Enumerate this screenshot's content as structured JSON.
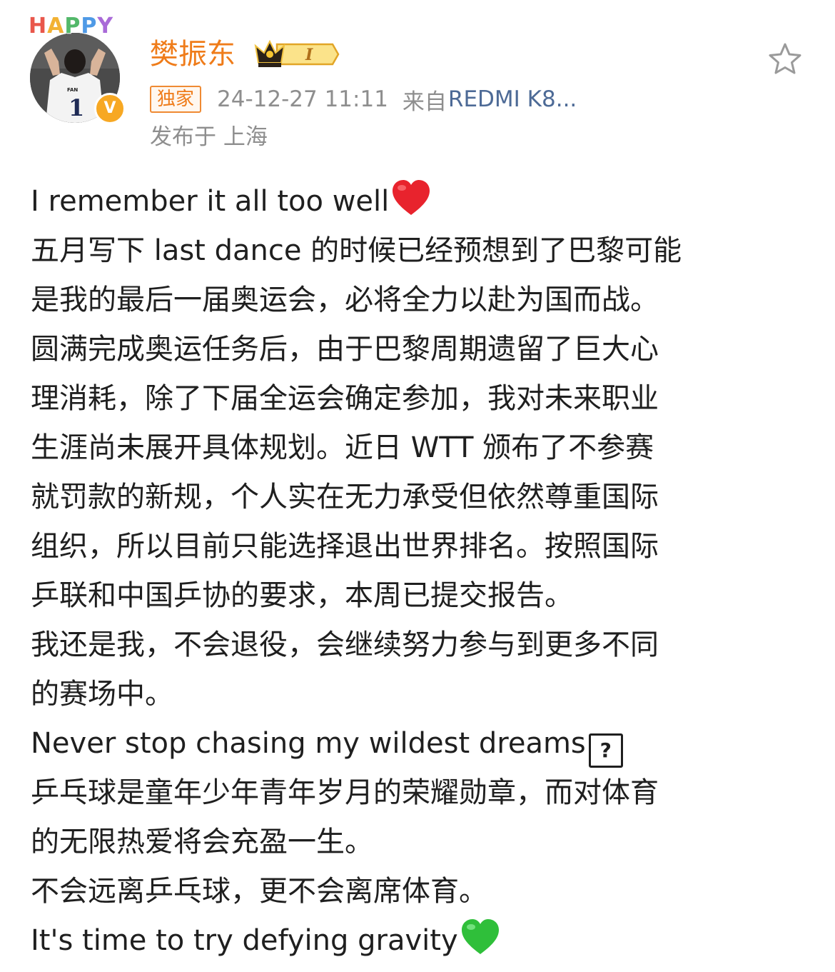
{
  "header": {
    "avatar_frame_text": "HAPPY",
    "verified_badge": "V",
    "username": "樊振东",
    "level_badge": "I",
    "exclusive_tag": "独家",
    "timestamp": "24-12-27 11:11",
    "source_prefix": "来自",
    "source": "REDMI K8...",
    "location": "发布于 上海",
    "favorite_icon": "star-outline-icon",
    "jersey_text": "FAN",
    "jersey_number": "1"
  },
  "post": {
    "lines": [
      "I remember it all too well",
      "五月写下 last dance 的时候已经预想到了巴黎可能",
      "是我的最后一届奥运会，必将全力以赴为国而战。",
      "圆满完成奥运任务后，由于巴黎周期遗留了巨大心",
      "理消耗，除了下届全运会确定参加，我对未来职业",
      "生涯尚未展开具体规划。近日 WTT 颁布了不参赛",
      "就罚款的新规，个人实在无力承受但依然尊重国际",
      "组织，所以目前只能选择退出世界排名。按照国际",
      "乒联和中国乒协的要求，本周已提交报告。",
      "我还是我，不会退役，会继续努力参与到更多不同",
      "的赛场中。",
      "Never stop chasing my wildest dreams",
      "乒乓球是童年少年青年岁月的荣耀勋章，而对体育",
      "的无限热爱将会充盈一生。",
      "不会远离乒乓球，更不会离席体育。",
      "It's time to try defying gravity"
    ],
    "unknown_glyph": "?",
    "emoji_icons": [
      "red-heart-icon",
      "unknown-glyph-icon",
      "green-heart-icon"
    ]
  },
  "colors": {
    "username": "#ef7c1a",
    "meta_gray": "#8e8e8e",
    "source_link": "#4d6a96",
    "body_text": "#1f1f1f",
    "red_heart": "#e8232d",
    "green_heart": "#2fbf3a"
  }
}
